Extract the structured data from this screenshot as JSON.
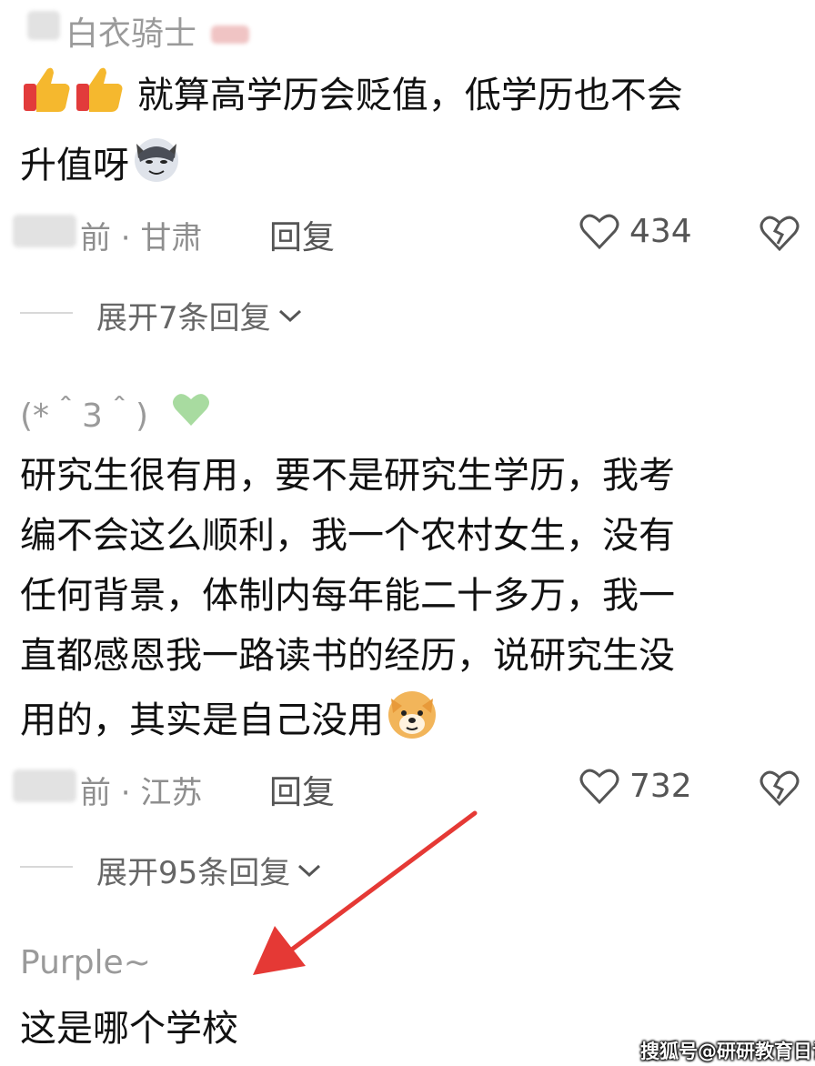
{
  "comments": [
    {
      "username": "白衣骑士",
      "content_lines": [
        "就算高学历会贬值，低学历也不会",
        "升值呀"
      ],
      "location": "前 · 甘肃",
      "reply_label": "回复",
      "likes": "434",
      "expand_label": "展开7条回复"
    },
    {
      "username": "(*＾3＾)",
      "content_lines": [
        "研究生很有用，要不是研究生学历，我考",
        "编不会这么顺利，我一个农村女生，没有",
        "任何背景，体制内每年能二十多万，我一",
        "直都感恩我一路读书的经历，说研究生没",
        "用的，其实是自己没用"
      ],
      "location": "前 · 江苏",
      "reply_label": "回复",
      "likes": "732",
      "expand_label": "展开95条回复"
    },
    {
      "username": "Purple~",
      "content_lines": [
        "这是哪个学校"
      ]
    }
  ],
  "watermark": "搜狐号@研研教育日记",
  "colors": {
    "arrow": "#e53935",
    "green_heart": "#a8dba0",
    "thumb": "#f5b82e"
  }
}
